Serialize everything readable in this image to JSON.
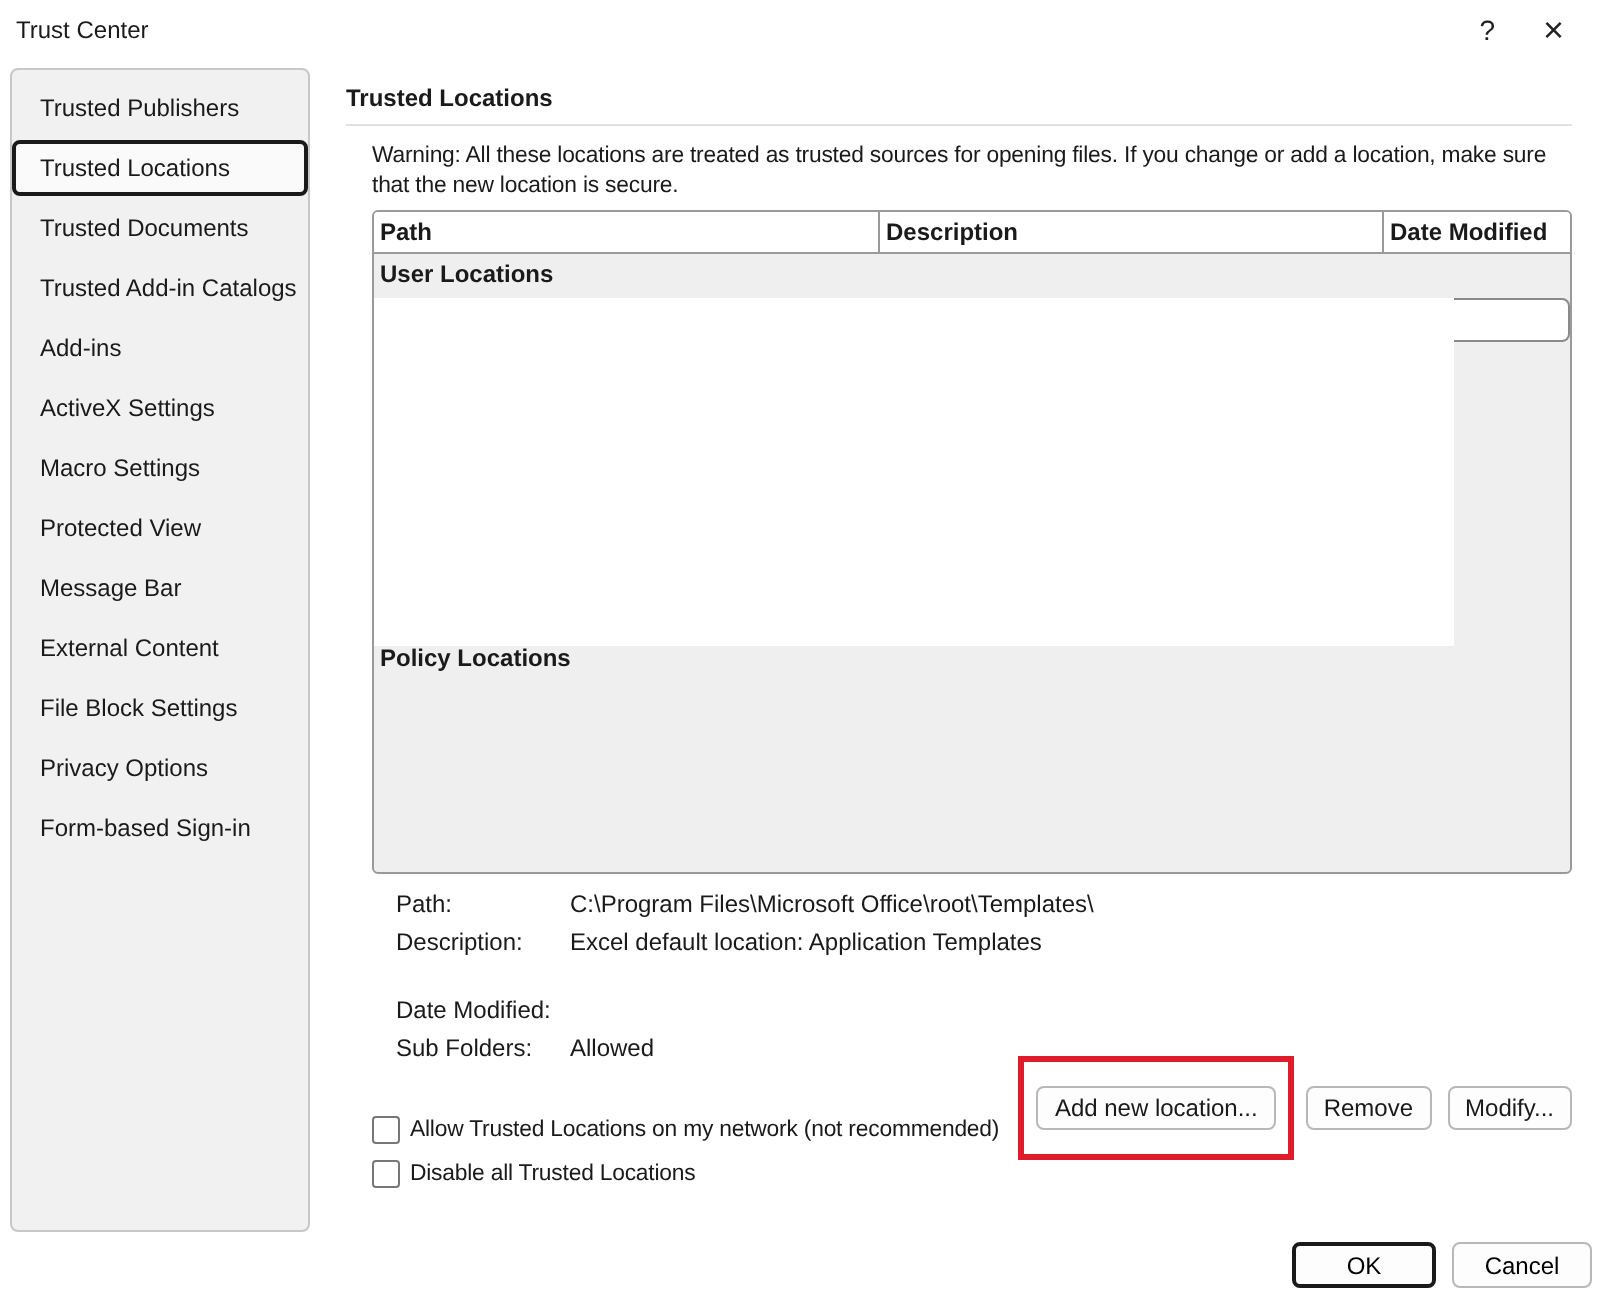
{
  "window": {
    "title": "Trust Center",
    "help": "?",
    "close": "×"
  },
  "sidebar": {
    "items": [
      {
        "label": "Trusted Publishers",
        "selected": false
      },
      {
        "label": "Trusted Locations",
        "selected": true
      },
      {
        "label": "Trusted Documents",
        "selected": false
      },
      {
        "label": "Trusted Add-in Catalogs",
        "selected": false
      },
      {
        "label": "Add-ins",
        "selected": false
      },
      {
        "label": "ActiveX Settings",
        "selected": false
      },
      {
        "label": "Macro Settings",
        "selected": false
      },
      {
        "label": "Protected View",
        "selected": false
      },
      {
        "label": "Message Bar",
        "selected": false
      },
      {
        "label": "External Content",
        "selected": false
      },
      {
        "label": "File Block Settings",
        "selected": false
      },
      {
        "label": "Privacy Options",
        "selected": false
      },
      {
        "label": "Form-based Sign-in",
        "selected": false
      }
    ]
  },
  "section": {
    "title": "Trusted Locations",
    "warning": "Warning: All these locations are treated as trusted sources for opening files.  If you change or add a location, make sure that the new location is secure."
  },
  "table": {
    "columns": [
      "Path",
      "Description",
      "Date Modified"
    ],
    "groups": [
      {
        "label": "User Locations"
      },
      {
        "label": "Policy Locations"
      }
    ]
  },
  "details": [
    {
      "label": "Path:",
      "value": "C:\\Program Files\\Microsoft Office\\root\\Templates\\"
    },
    {
      "label": "Description:",
      "value": "Excel default location: Application Templates"
    },
    {
      "label": "Date Modified:"
    },
    {
      "label": "Sub Folders:",
      "value": "Allowed"
    }
  ],
  "actions": [
    {
      "label": "Add new location...",
      "highlighted": true
    },
    {
      "label": "Remove",
      "highlighted": false
    },
    {
      "label": "Modify...",
      "highlighted": false
    }
  ],
  "options": [
    {
      "label": "Allow Trusted Locations on my network (not recommended)",
      "checked": false
    },
    {
      "label": "Disable all Trusted Locations",
      "checked": false
    }
  ],
  "buttons": [
    {
      "label": "OK",
      "default": true
    },
    {
      "label": "Cancel",
      "default": false
    }
  ]
}
